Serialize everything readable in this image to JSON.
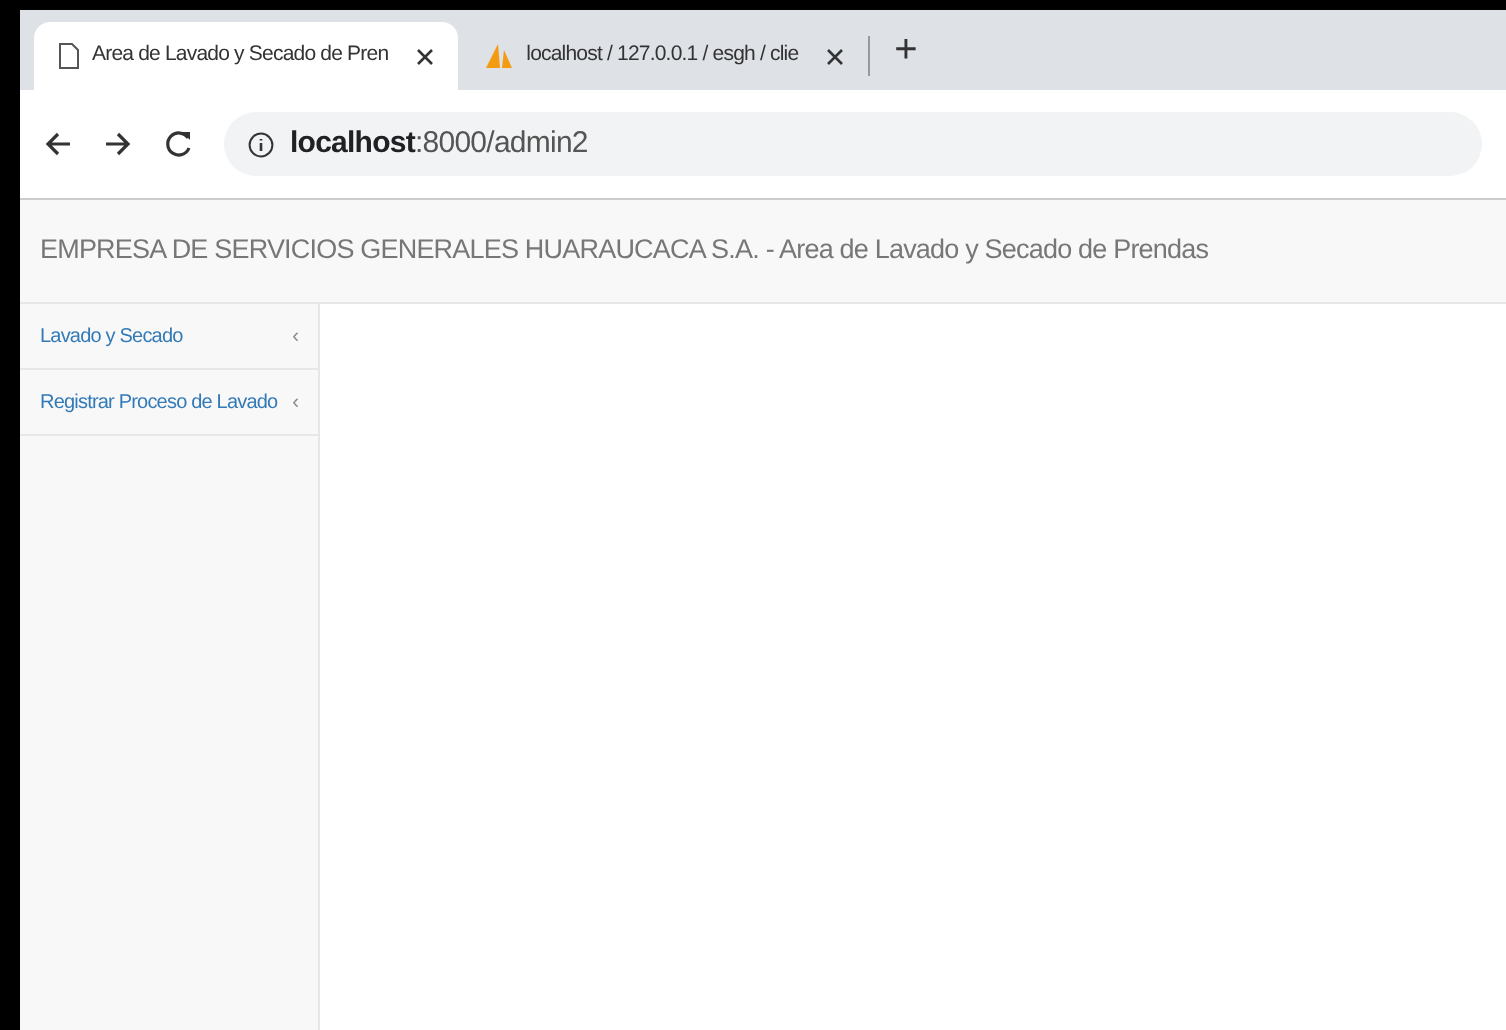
{
  "tabs": [
    {
      "title": "Area de Lavado y Secado de Pren",
      "selected": true,
      "kind": "page"
    },
    {
      "title": "localhost / 127.0.0.1 / esgh / clie",
      "selected": false,
      "kind": "pma"
    }
  ],
  "new_tab": "+",
  "address_bar": {
    "host": "localhost",
    "path": ":8000/admin2"
  },
  "header": {
    "title": "EMPRESA DE SERVICIOS GENERALES HUARAUCACA S.A. - Area de Lavado y Secado de Prendas"
  },
  "sidebar": {
    "items": [
      {
        "label": "Lavado y Secado",
        "chevron": "‹"
      },
      {
        "label": "Registrar Proceso de Lavado",
        "chevron": "‹"
      }
    ]
  }
}
